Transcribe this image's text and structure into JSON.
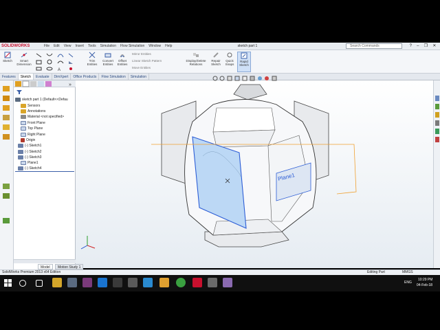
{
  "app": {
    "logo_text": "SOLIDWORKS",
    "doc_title": "sketch part 1",
    "search_placeholder": "Search Commands"
  },
  "menu": [
    "File",
    "Edit",
    "View",
    "Insert",
    "Tools",
    "Simulation",
    "Flow Simulation",
    "Window",
    "Help"
  ],
  "window_buttons": [
    "?",
    "–",
    "❐",
    "✕"
  ],
  "ribbon": {
    "sketch": "Sketch",
    "smart_dimension": "Smart Dimension",
    "trim_entities": "Trim Entities",
    "convert_entities": "Convert Entities",
    "offset_entities": "Offset Entities",
    "mirror_entities": "Mirror Entities",
    "linear_sketch_pattern": "Linear Sketch Pattern",
    "move_entities": "Move Entities",
    "display_delete_relations": "Display/Delete Relations",
    "repair_sketch": "Repair Sketch",
    "quick_snaps": "Quick Snaps",
    "rapid_sketch": "Rapid Sketch"
  },
  "tabs": [
    "Features",
    "Sketch",
    "Evaluate",
    "DimXpert",
    "Office Products",
    "Flow Simulation",
    "Simulation"
  ],
  "active_tab": "Sketch",
  "tree": [
    "sketch part 1  (Default<<Defau",
    "Sensors",
    "Annotations",
    "Material <not specified>",
    "Front Plane",
    "Top Plane",
    "Right Plane",
    "Origin",
    "(-) Sketch1",
    "(-) Sketch2",
    "(-) Sketch3",
    "Plane1",
    "(-) Sketch4"
  ],
  "tree_icon_colors": [
    "#5b6b80",
    "#d9a52a",
    "#d9a52a",
    "#8a8a8a",
    "#c9d6ea",
    "#c9d6ea",
    "#c9d6ea",
    "#b03a2e",
    "#6a7fa8",
    "#6a7fa8",
    "#6a7fa8",
    "#c9d6ea",
    "#6a7fa8"
  ],
  "plane_label": "Plane1",
  "bottom_tabs": [
    "Model",
    "Motion Study 1"
  ],
  "status": {
    "edition": "SolidWorks Premium 2013 x64 Edition",
    "mode": "Editing Part",
    "units": "MMGS"
  },
  "taskbar": {
    "lang": "ENG",
    "time": "10:29 PM",
    "date": "04-Feb-18"
  },
  "colors": {
    "accent": "#2a4a80",
    "selection": "#2c5dd6",
    "plane_orange": "#f0a030",
    "sw_red": "#c8102e"
  }
}
